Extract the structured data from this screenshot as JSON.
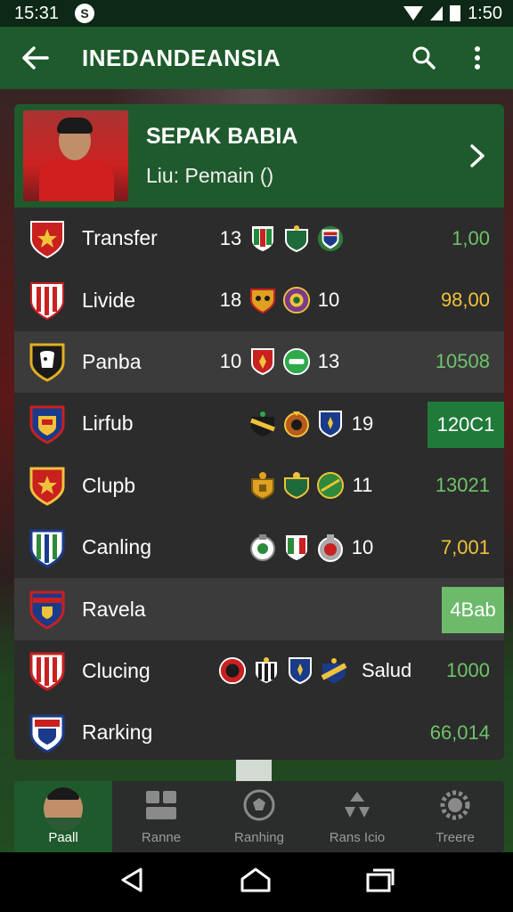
{
  "status_bar": {
    "time_left": "15:31",
    "app_icon": "S",
    "time_right": "1:50"
  },
  "app_bar": {
    "title": "INEDANDEANSIA"
  },
  "header": {
    "title": "SEPAK BABIA",
    "subtitle": "Liu: Pemain ()"
  },
  "rows": [
    {
      "team": "Transfer",
      "num1": "13",
      "num2": "",
      "extra": "",
      "value": "1,00"
    },
    {
      "team": "Livide",
      "num1": "18",
      "num2": "10",
      "extra": "",
      "value": "98,00"
    },
    {
      "team": "Panba",
      "num1": "10",
      "num2": "13",
      "extra": "",
      "value": "10508"
    },
    {
      "team": "Lirfub",
      "num1": "",
      "num2": "19",
      "extra": "",
      "value": "120C1"
    },
    {
      "team": "Clupb",
      "num1": "",
      "num2": "11",
      "extra": "",
      "value": "13021"
    },
    {
      "team": "Canling",
      "num1": "",
      "num2": "10",
      "extra": "",
      "value": "7,001"
    },
    {
      "team": "Ravela",
      "num1": "",
      "num2": "",
      "extra": "",
      "value": "4Bab"
    },
    {
      "team": "Clucing",
      "num1": "",
      "num2": "",
      "extra": "Salud",
      "value": "1000"
    },
    {
      "team": "Rarking",
      "num1": "",
      "num2": "",
      "extra": "",
      "value": "66,014"
    }
  ],
  "bottom_nav": [
    {
      "label": "Paall"
    },
    {
      "label": "Ranne"
    },
    {
      "label": "Ranhing"
    },
    {
      "label": "Rans Icio"
    },
    {
      "label": "Treere"
    }
  ],
  "colors": {
    "header_green": "#1e5a2c",
    "value_green": "#6ec36a",
    "value_yellow": "#f0c23b"
  }
}
